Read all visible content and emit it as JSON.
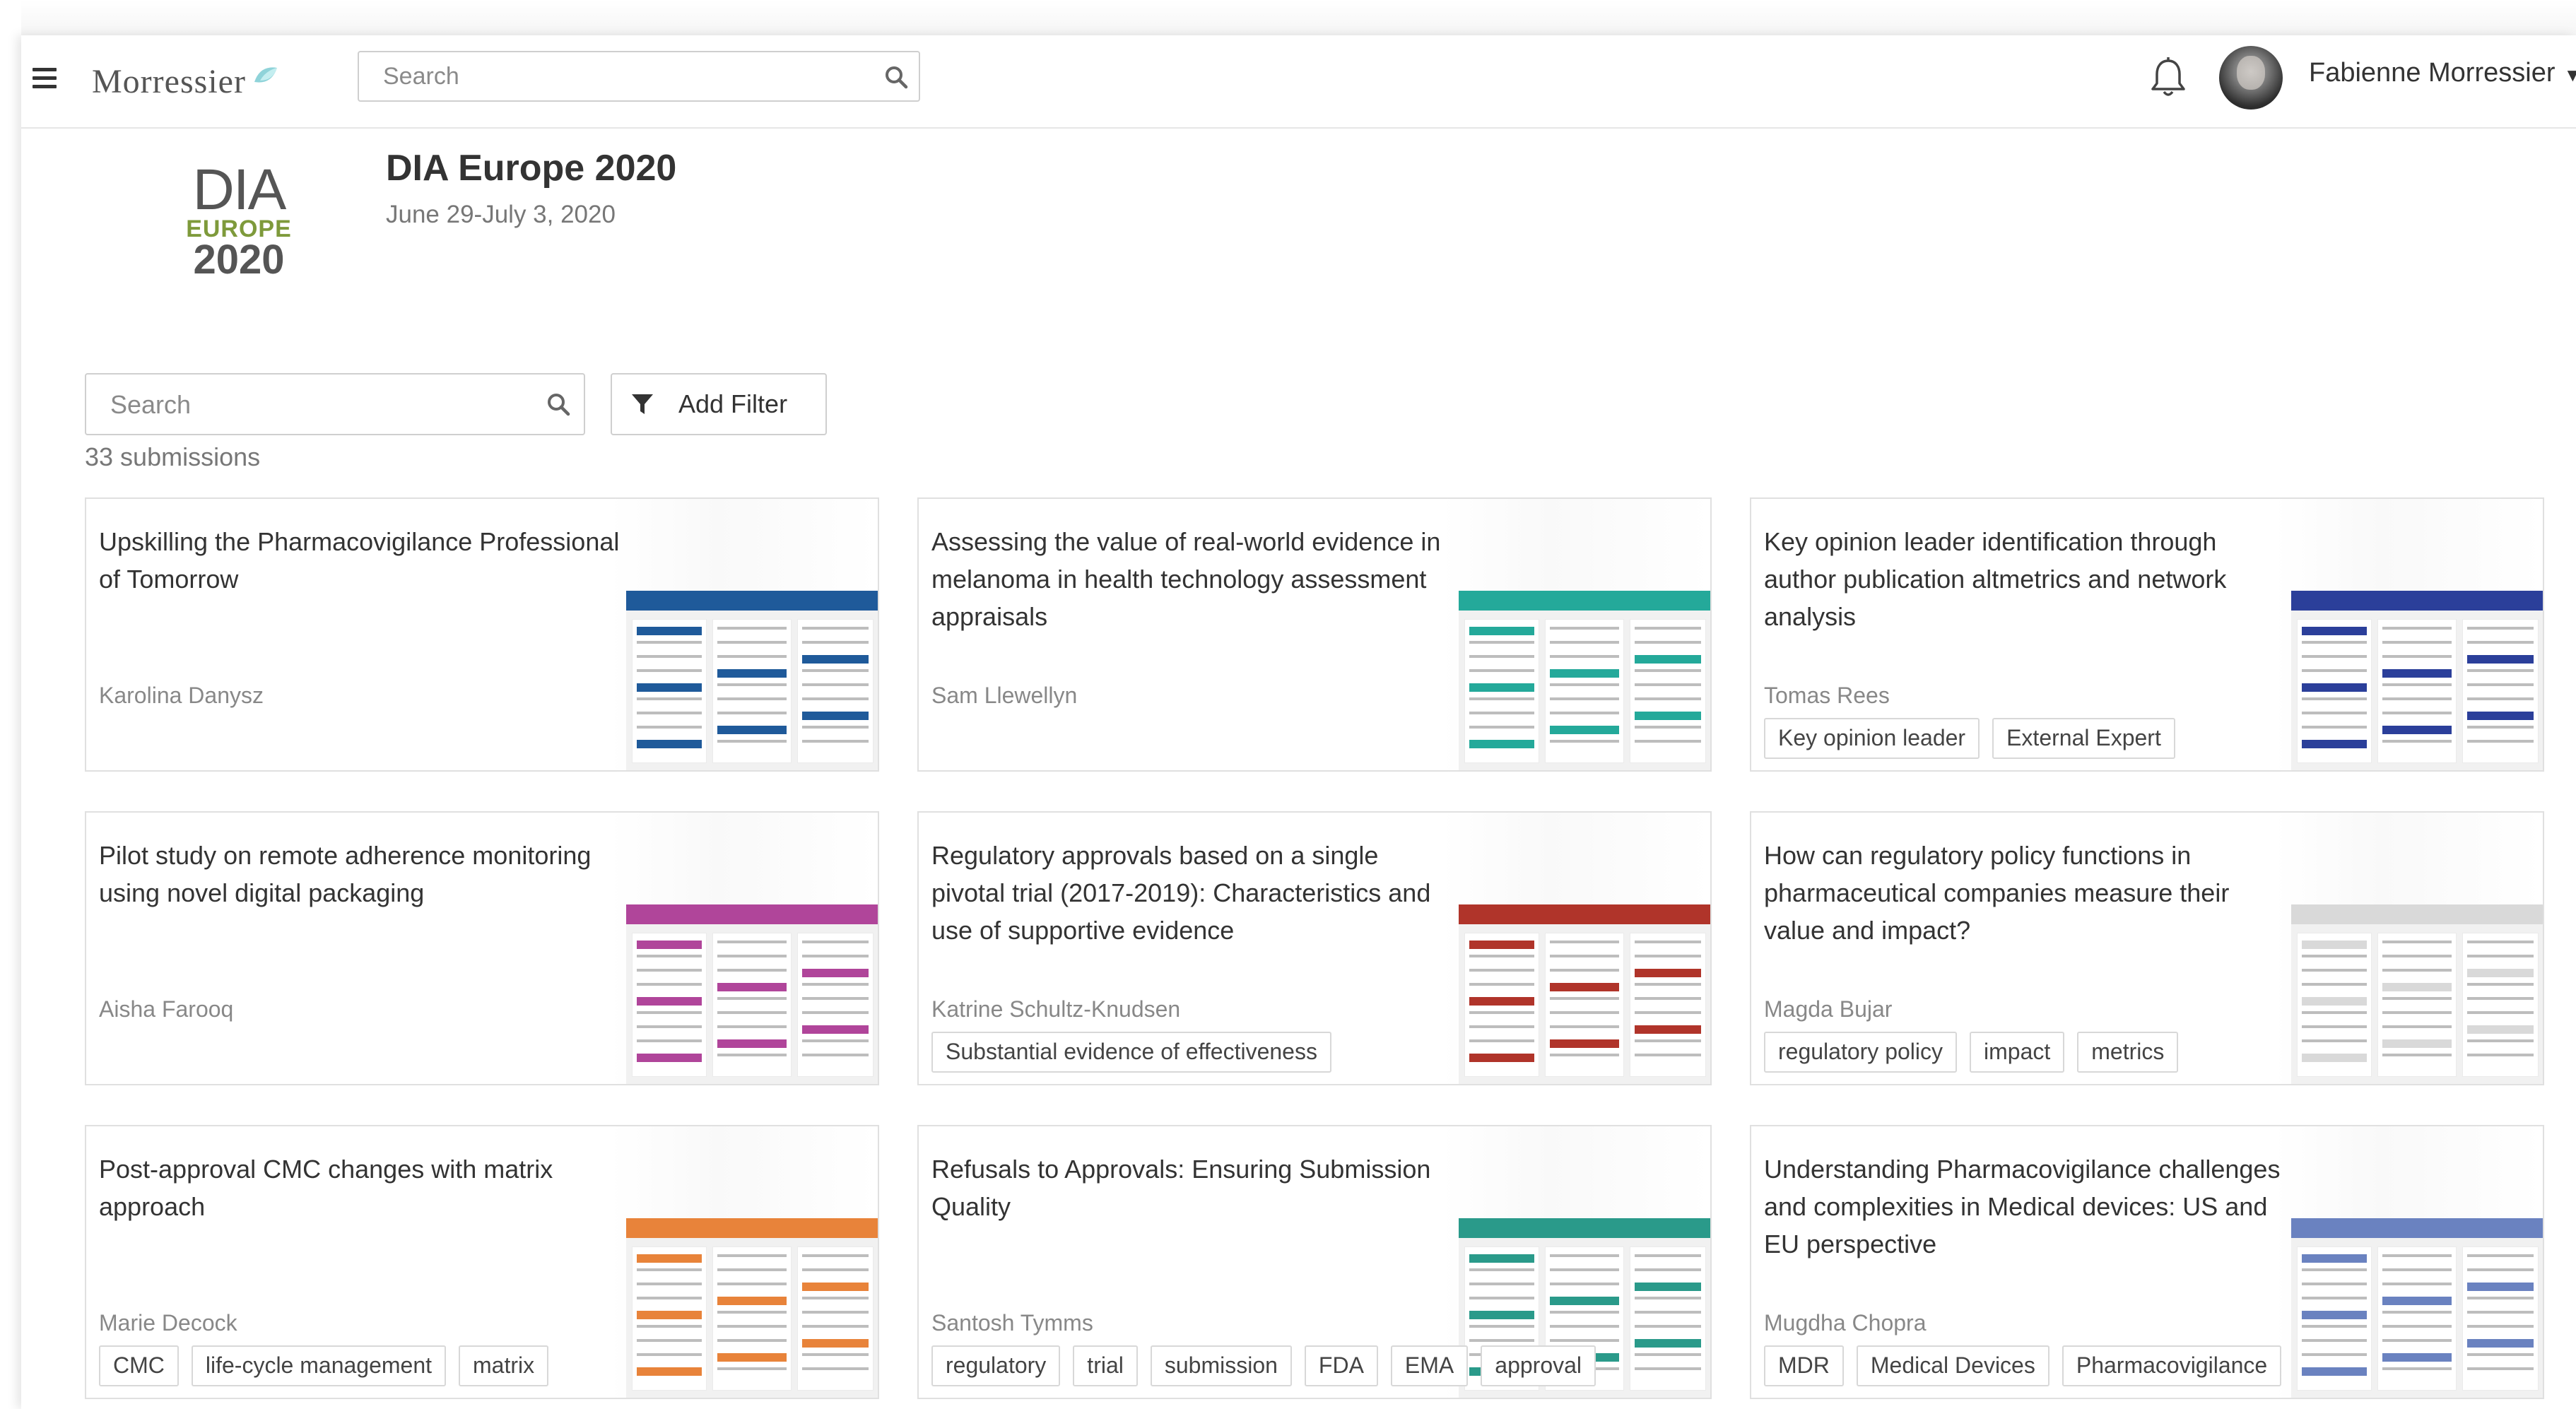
{
  "header": {
    "logo_text": "Morressier",
    "search_placeholder": "Search",
    "user_name": "Fabienne Morressier",
    "user_caret": "▼"
  },
  "event": {
    "logo_dia": "DIA",
    "logo_europe": "EUROPE",
    "logo_year": "2020",
    "title": "DIA Europe 2020",
    "dates": "June 29-July 3, 2020"
  },
  "filters": {
    "search_placeholder": "Search",
    "add_filter_label": "Add Filter",
    "count_text": "33 submissions"
  },
  "cards": [
    {
      "title": "Upskilling the Pharmacovigilance Professional of Tomorrow",
      "author": "Karolina Danysz",
      "tags": [],
      "poster_color": "#1f5a9a"
    },
    {
      "title": "Assessing the value of real-world evidence in melanoma in health technology assessment appraisals",
      "author": "Sam Llewellyn",
      "tags": [],
      "poster_color": "#24a99a"
    },
    {
      "title": "Key opinion leader identification through author publication altmetrics and network analysis",
      "author": "Tomas Rees",
      "tags": [
        "Key opinion leader",
        "External Expert"
      ],
      "poster_color": "#2b3f9a"
    },
    {
      "title": "Pilot study on remote adherence monitoring using novel digital packaging",
      "author": "Aisha Farooq",
      "tags": [],
      "poster_color": "#b0459a"
    },
    {
      "title": "Regulatory approvals based on a single pivotal trial (2017-2019): Characteristics and use of supportive evidence",
      "author": "Katrine Schultz-Knudsen",
      "tags": [
        "Substantial evidence of effectiveness"
      ],
      "poster_color": "#b0342a"
    },
    {
      "title": "How can regulatory policy functions in pharmaceutical companies measure their value and impact?",
      "author": "Magda Bujar",
      "tags": [
        "regulatory policy",
        "impact",
        "metrics"
      ],
      "poster_color": "#d9d9d9"
    },
    {
      "title": "Post-approval CMC changes with matrix approach",
      "author": "Marie Decock",
      "tags": [
        "CMC",
        "life-cycle management",
        "matrix"
      ],
      "poster_color": "#e8833a"
    },
    {
      "title": "Refusals to Approvals: Ensuring Submission Quality",
      "author": "Santosh Tymms",
      "tags": [
        "regulatory",
        "trial",
        "submission",
        "FDA",
        "EMA",
        "approval"
      ],
      "poster_color": "#2a9a8a"
    },
    {
      "title": "Understanding Pharmacovigilance challenges and complexities in Medical devices: US and EU perspective",
      "author": "Mugdha Chopra",
      "tags": [
        "MDR",
        "Medical Devices",
        "Pharmacovigilance"
      ],
      "poster_color": "#6a82c0"
    }
  ]
}
